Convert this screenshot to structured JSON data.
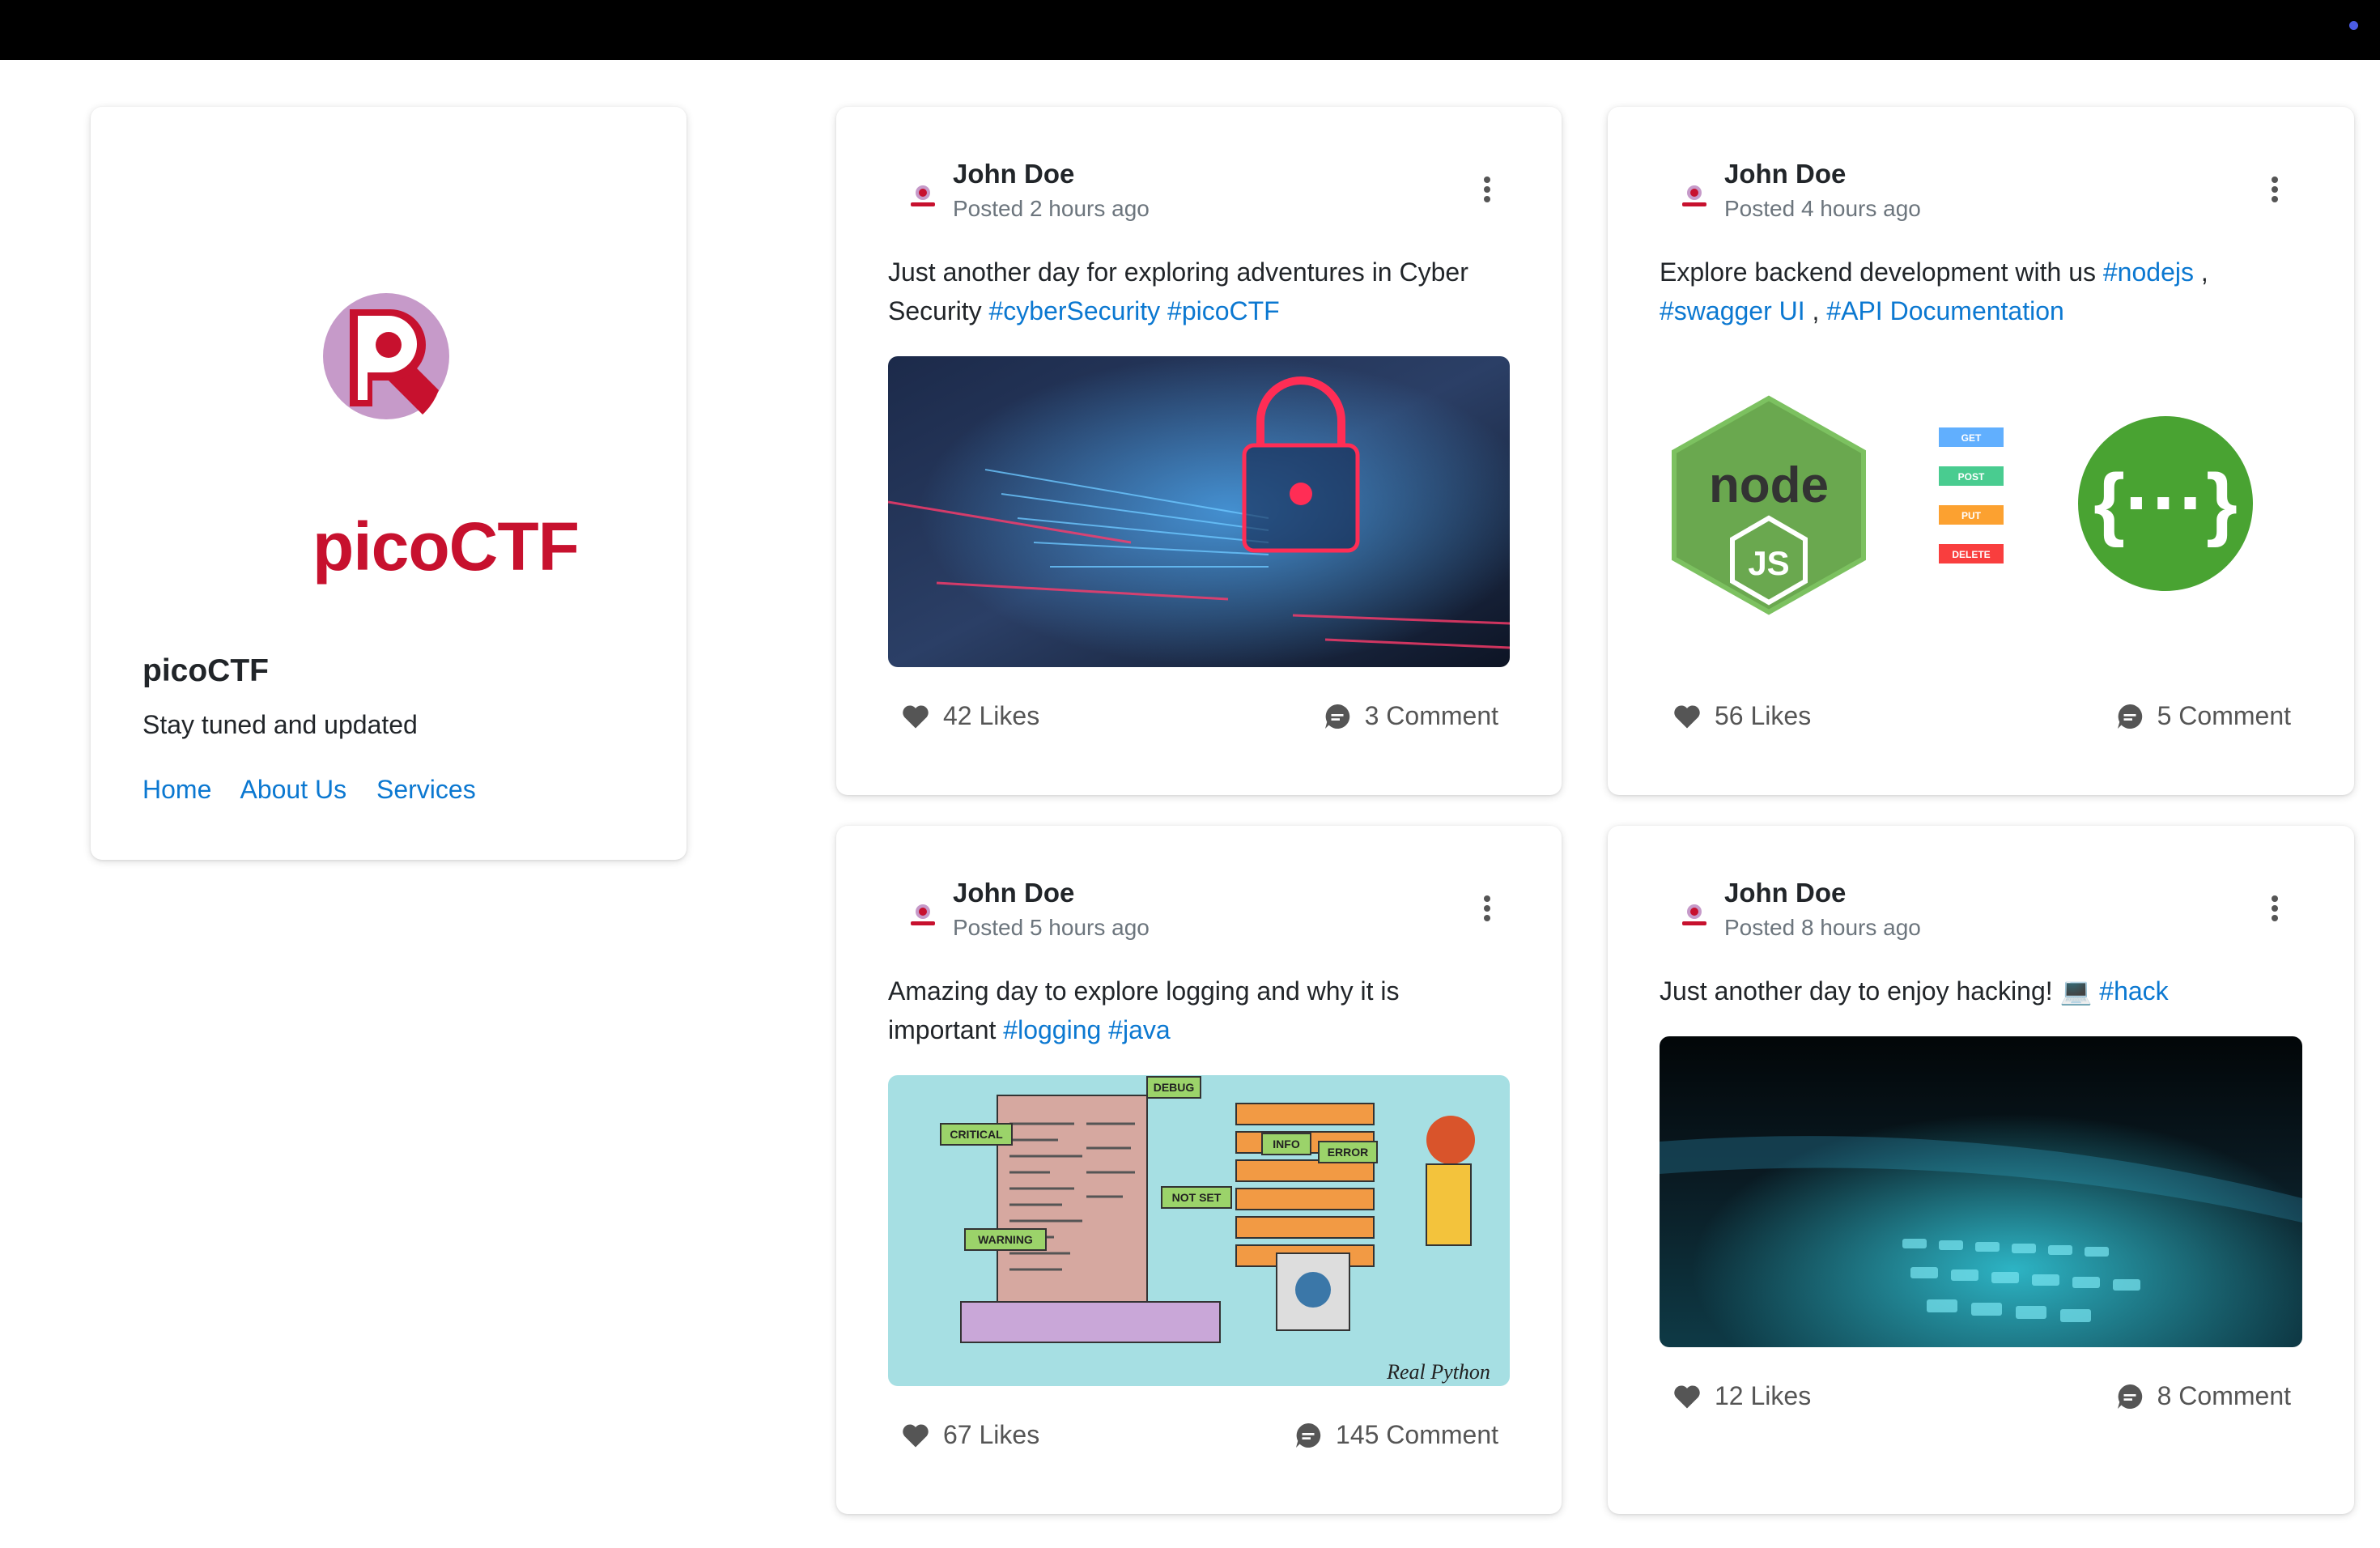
{
  "profile": {
    "logo_text": "picoCTF",
    "title": "picoCTF",
    "description": "Stay tuned and updated",
    "links": [
      "Home",
      "About Us",
      "Services"
    ]
  },
  "posts": [
    {
      "author": "John Doe",
      "time": "Posted 2 hours ago",
      "text": "Just another day for exploring adventures in Cyber Security",
      "tags": [
        "#cyberSecurity",
        "#picoCTF"
      ],
      "likes": "42 Likes",
      "comments": "3 Comment",
      "image": "padlock-circuit-board"
    },
    {
      "author": "John Doe",
      "time": "Posted 4 hours ago",
      "text": "Explore backend development with us",
      "tags": [
        "#nodejs",
        "#swagger UI",
        "#API Documentation"
      ],
      "separators": [
        " ,",
        " ,"
      ],
      "likes": "56 Likes",
      "comments": "5 Comment",
      "image": "nodejs-swagger-logos",
      "image_labels": {
        "node_logo": "node",
        "node_js": "JS",
        "methods": [
          "GET",
          "POST",
          "PUT",
          "DELETE"
        ],
        "swagger": "{···}"
      }
    },
    {
      "author": "John Doe",
      "time": "Posted 5 hours ago",
      "text": "Amazing day to explore logging and why it is important",
      "tags": [
        "#logging",
        "#java"
      ],
      "likes": "67 Likes",
      "comments": "145 Comment",
      "image": "logging-illustration",
      "image_labels": {
        "tags": [
          "DEBUG",
          "CRITICAL",
          "INFO",
          "ERROR",
          "NOT SET",
          "WARNING"
        ],
        "brand": "Real Python"
      }
    },
    {
      "author": "John Doe",
      "time": "Posted 8 hours ago",
      "text": "Just another day to enjoy hacking! 💻",
      "tags": [
        "#hack"
      ],
      "likes": "12 Likes",
      "comments": "8 Comment",
      "image": "laptop-keyboard"
    }
  ],
  "colors": {
    "link": "#0b78d1",
    "brand_red": "#c7112e",
    "brand_purple": "#c69ac9",
    "topbar": "#000000"
  }
}
